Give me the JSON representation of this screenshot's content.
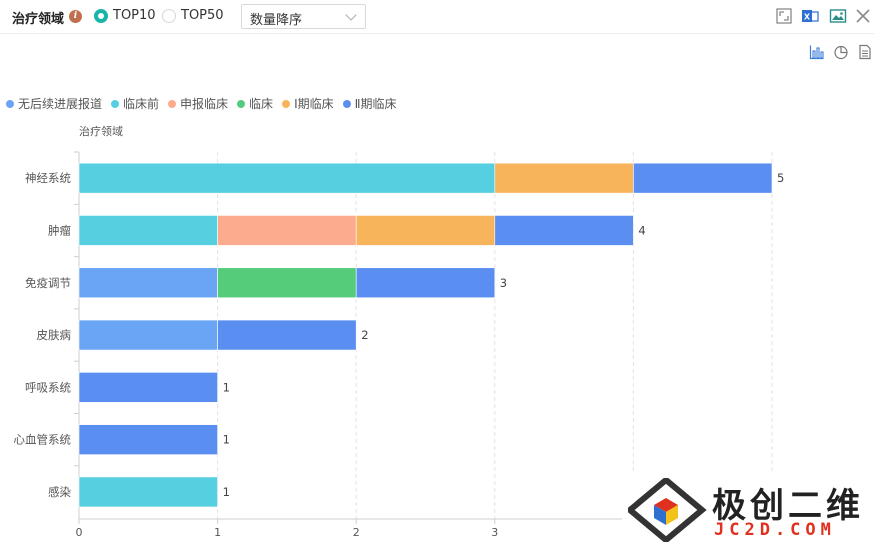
{
  "toolbar": {
    "title": "治疗领域",
    "info_icon": "i",
    "radio_top10": "TOP10",
    "radio_top50": "TOP50",
    "selected_radio": "TOP10",
    "sort_value": "数量降序",
    "icons": [
      "fullscreen-icon",
      "excel-export-icon",
      "image-export-icon",
      "close-icon"
    ]
  },
  "chart_toggle_icons": [
    "bar-chart-icon",
    "pie-chart-icon",
    "table-view-icon"
  ],
  "colors": {
    "accent": "#1bb5a8",
    "无后续进展报道": "#6aa5f5",
    "临床前": "#56d0e0",
    "申报临床": "#fdab8e",
    "临床": "#55cc7a",
    "Ⅰ期临床": "#f8b45a",
    "Ⅱ期临床": "#5b8ef1"
  },
  "watermark": {
    "big": "极创二维",
    "small": "JC2D.COM"
  },
  "chart_data": {
    "type": "bar",
    "orientation": "horizontal",
    "stacked": true,
    "ylabel": "治疗领域",
    "categories": [
      "神经系统",
      "肿瘤",
      "免疫调节",
      "皮肤病",
      "呼吸系统",
      "心血管系统",
      "感染"
    ],
    "series": [
      {
        "name": "无后续进展报道",
        "values": [
          0,
          0,
          1,
          1,
          0,
          0,
          0
        ]
      },
      {
        "name": "临床前",
        "values": [
          3,
          1,
          0,
          0,
          0,
          0,
          1
        ]
      },
      {
        "name": "申报临床",
        "values": [
          0,
          1,
          0,
          0,
          0,
          0,
          0
        ]
      },
      {
        "name": "临床",
        "values": [
          0,
          0,
          1,
          0,
          0,
          0,
          0
        ]
      },
      {
        "name": "Ⅰ期临床",
        "values": [
          1,
          1,
          0,
          0,
          0,
          0,
          0
        ]
      },
      {
        "name": "Ⅱ期临床",
        "values": [
          1,
          1,
          1,
          1,
          1,
          1,
          0
        ]
      }
    ],
    "totals": [
      5,
      4,
      3,
      2,
      1,
      1,
      1
    ],
    "xticks": [
      0,
      1,
      2,
      3
    ],
    "xlim": [
      0,
      5
    ],
    "grid": true,
    "legend_position": "top-left"
  }
}
